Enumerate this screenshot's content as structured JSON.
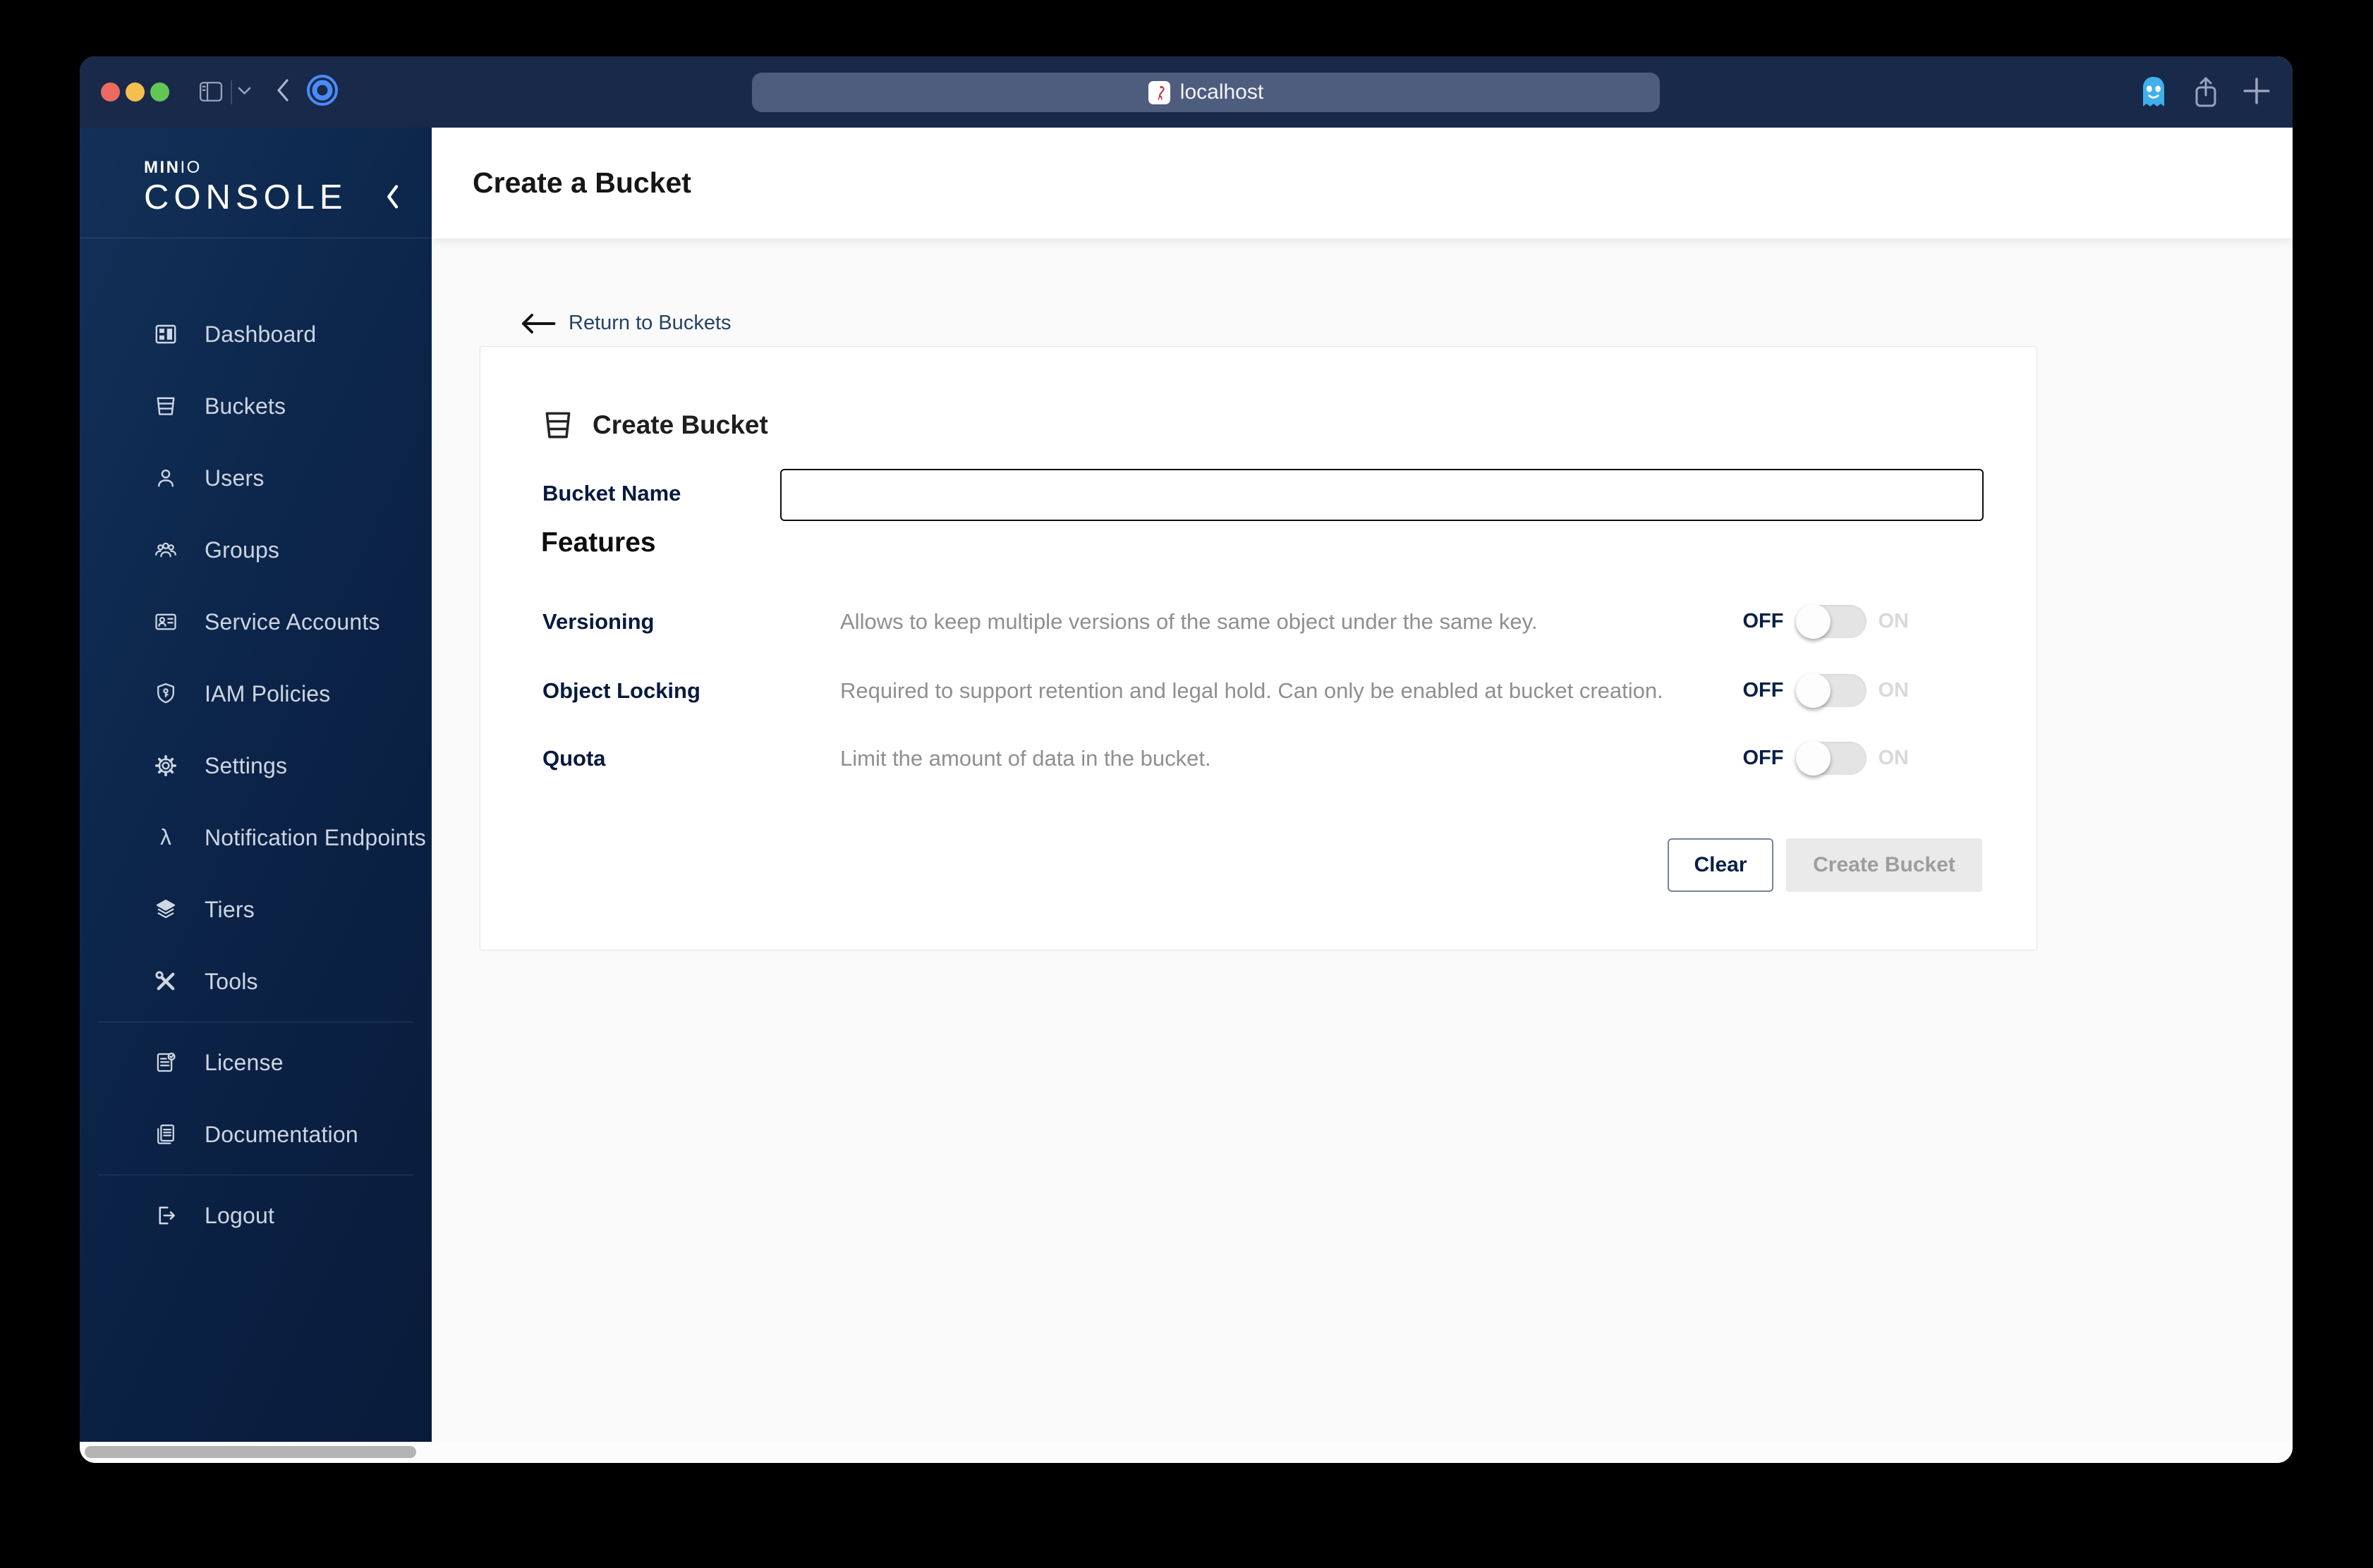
{
  "browser": {
    "url": "localhost",
    "traffic_lights": [
      "close",
      "minimize",
      "zoom"
    ]
  },
  "sidebar": {
    "brand": {
      "mark_bold": "MIN",
      "mark_light": "IO",
      "name": "CONSOLE"
    },
    "items": [
      {
        "icon": "dashboard-icon",
        "label": "Dashboard"
      },
      {
        "icon": "buckets-icon",
        "label": "Buckets"
      },
      {
        "icon": "users-icon",
        "label": "Users"
      },
      {
        "icon": "groups-icon",
        "label": "Groups"
      },
      {
        "icon": "service-accounts-icon",
        "label": "Service Accounts"
      },
      {
        "icon": "iam-policies-icon",
        "label": "IAM Policies"
      },
      {
        "icon": "settings-icon",
        "label": "Settings"
      },
      {
        "icon": "notification-endpoints-icon",
        "label": "Notification Endpoints"
      },
      {
        "icon": "tiers-icon",
        "label": "Tiers"
      },
      {
        "icon": "tools-icon",
        "label": "Tools"
      },
      {
        "icon": "license-icon",
        "label": "License"
      },
      {
        "icon": "documentation-icon",
        "label": "Documentation"
      },
      {
        "icon": "logout-icon",
        "label": "Logout"
      }
    ]
  },
  "header": {
    "title": "Create a Bucket"
  },
  "content": {
    "back_link": "Return to Buckets",
    "card": {
      "title": "Create Bucket",
      "bucket_name": {
        "label": "Bucket Name",
        "value": ""
      },
      "features_heading": "Features",
      "features": [
        {
          "label": "Versioning",
          "description": "Allows to keep multiple versions of the same object under the same key.",
          "state": "off",
          "off_label": "OFF",
          "on_label": "ON"
        },
        {
          "label": "Object Locking",
          "description": "Required to support retention and legal hold. Can only be enabled at bucket creation.",
          "state": "off",
          "off_label": "OFF",
          "on_label": "ON"
        },
        {
          "label": "Quota",
          "description": "Limit the amount of data in the bucket.",
          "state": "off",
          "off_label": "OFF",
          "on_label": "ON"
        }
      ],
      "actions": {
        "clear": "Clear",
        "create": "Create Bucket"
      }
    }
  },
  "colors": {
    "titlebar": "#18294A",
    "urlbar": "#4E5C7E",
    "sidebar_gradient_start": "#123158",
    "sidebar_gradient_end": "#081B3A",
    "accent_navy": "#07193E",
    "content_bg": "#FAFAFA",
    "muted_text": "#8F8F8F",
    "toggle_track": "#E4E4E4",
    "disabled_button_bg": "#EAEAEA",
    "disabled_button_text": "#9D9D9D",
    "traffic_red": "#EC6A5E",
    "traffic_yellow": "#F5BF4F",
    "traffic_green": "#62C554"
  }
}
